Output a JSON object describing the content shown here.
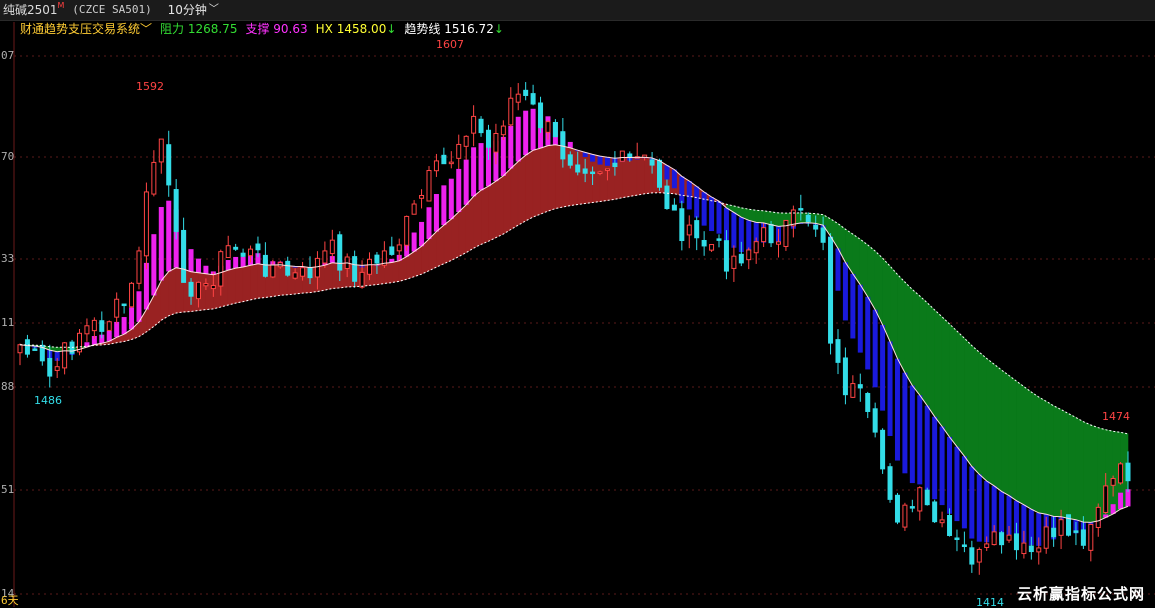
{
  "header": {
    "symbol": "纯碱2501",
    "symbol_mark": "M",
    "code": "(CZCE SA501)",
    "period": "10分钟"
  },
  "indicator": {
    "name": "财通趋势支压交易系统",
    "items": [
      {
        "label": "阻力",
        "value": "1268.75",
        "color": "#33dd33"
      },
      {
        "label": "支撑",
        "value": "90.63",
        "color": "#ff33ff"
      },
      {
        "label": "HX",
        "value": "1458.00",
        "color": "#ffff33",
        "arrow": "↓",
        "arrow_color": "#33dd33"
      },
      {
        "label": "趋势线",
        "value": "1516.72",
        "color": "#ffffff",
        "arrow": "↓",
        "arrow_color": "#33dd33"
      }
    ]
  },
  "axis": {
    "labels": [
      "07",
      "70",
      "33",
      "11",
      "88",
      "51",
      "14"
    ],
    "bottom_label": "6天"
  },
  "chart_data": {
    "type": "candlestick",
    "price_levels": [
      1607,
      1592,
      1486,
      1474,
      1414
    ],
    "annotations": [
      {
        "text": "1607",
        "kind": "high"
      },
      {
        "text": "1592",
        "kind": "high"
      },
      {
        "text": "1486",
        "kind": "low"
      },
      {
        "text": "1474",
        "kind": "high"
      },
      {
        "text": "1414",
        "kind": "low"
      }
    ],
    "series_colors": {
      "up": "#ff4444",
      "down": "#33dde8",
      "support_band": "#ee22ee",
      "fill_bull": "#992222",
      "resistance_band": "#1a1adc",
      "fill_bear": "#0a7a1a",
      "trend_line": "#ffffff"
    }
  },
  "watermark": "云析赢指标公式网"
}
